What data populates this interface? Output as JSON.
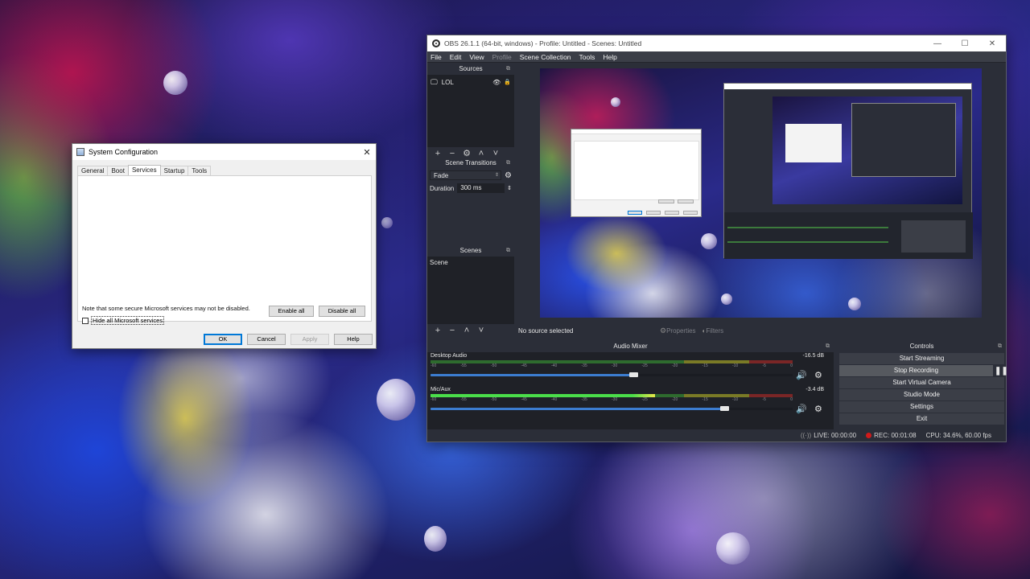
{
  "msconfig": {
    "title": "System Configuration",
    "close": "✕",
    "tabs": [
      "General",
      "Boot",
      "Services",
      "Startup",
      "Tools"
    ],
    "note": "Note that some secure Microsoft services may not be disabled.",
    "enable_all": "Enable all",
    "disable_all": "Disable all",
    "hide_ms": "Hide all Microsoft services",
    "ok": "OK",
    "cancel": "Cancel",
    "apply": "Apply",
    "help": "Help"
  },
  "obs": {
    "title": "OBS 26.1.1 (64-bit, windows) - Profile: Untitled - Scenes: Untitled",
    "window_controls": [
      "—",
      "☐",
      "✕"
    ],
    "menu": [
      "File",
      "Edit",
      "View",
      "Profile",
      "Scene Collection",
      "Tools",
      "Help"
    ],
    "sources": {
      "title": "Sources",
      "items": [
        {
          "label": "LOL"
        }
      ]
    },
    "transitions": {
      "title": "Scene Transitions",
      "type": "Fade",
      "duration_label": "Duration",
      "duration_value": "300 ms"
    },
    "scenes": {
      "title": "Scenes",
      "items": [
        "Scene"
      ]
    },
    "source_bar": {
      "no_source": "No source selected",
      "properties": "Properties",
      "filters": "Filters"
    },
    "mixer": {
      "title": "Audio Mixer",
      "scale": [
        "-60",
        "-55",
        "-50",
        "-45",
        "-40",
        "-35",
        "-30",
        "-25",
        "-20",
        "-15",
        "-10",
        "-5",
        "0"
      ],
      "channels": [
        {
          "name": "Desktop Audio",
          "db": "-16.5 dB",
          "volume": 0.56,
          "level": 0.0
        },
        {
          "name": "Mic/Aux",
          "db": "-3.4 dB",
          "volume": 0.81,
          "level": 0.62
        }
      ]
    },
    "controls": {
      "title": "Controls",
      "buttons": [
        "Start Streaming",
        "Stop Recording",
        "Start Virtual Camera",
        "Studio Mode",
        "Settings",
        "Exit"
      ]
    },
    "status": {
      "live": "LIVE: 00:00:00",
      "rec": "REC: 00:01:08",
      "cpu": "CPU: 34.6%, 60.00 fps"
    }
  }
}
